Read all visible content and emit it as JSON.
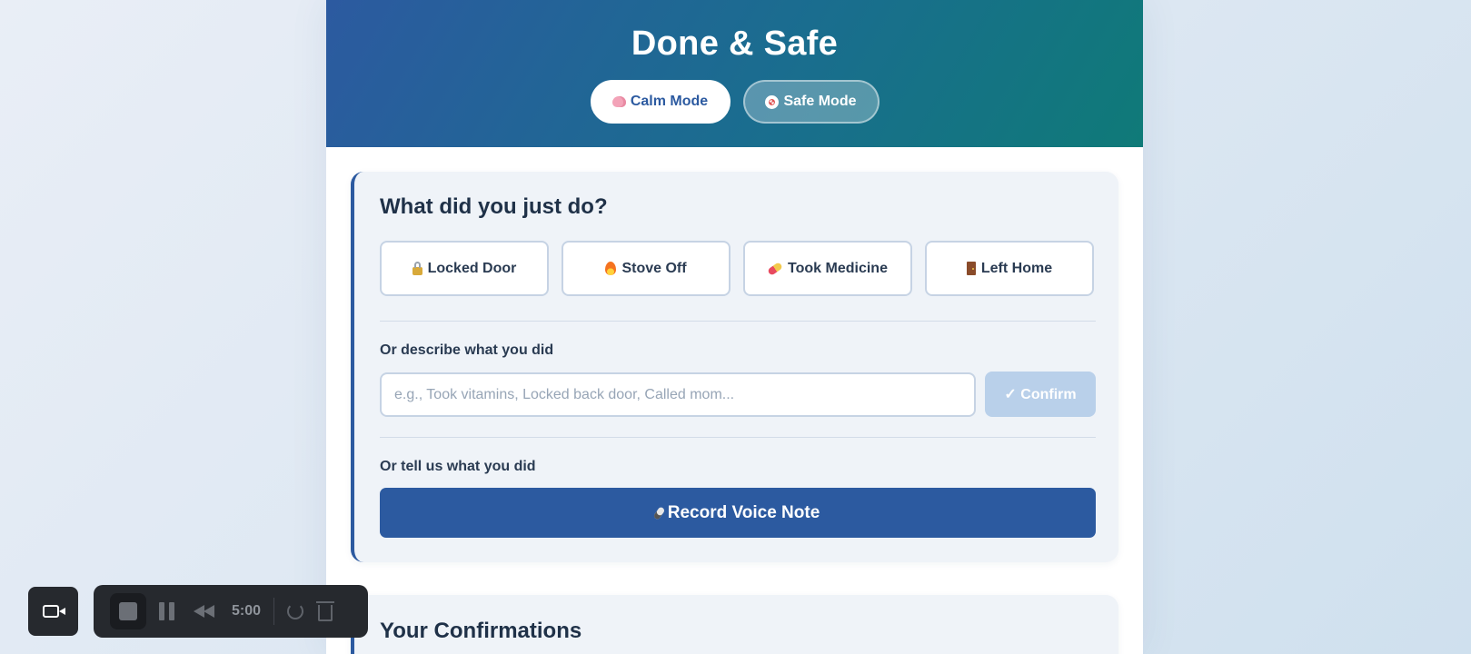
{
  "header": {
    "title": "Done & Safe",
    "modes": [
      {
        "label": "Calm Mode",
        "icon": "brain-icon"
      },
      {
        "label": "Safe Mode",
        "icon": "lifebuoy-icon"
      }
    ]
  },
  "log_card": {
    "title": "What did you just do?",
    "quick_actions": [
      {
        "label": "Locked Door",
        "icon": "lock-icon"
      },
      {
        "label": "Stove Off",
        "icon": "fire-icon"
      },
      {
        "label": "Took Medicine",
        "icon": "pill-icon"
      },
      {
        "label": "Left Home",
        "icon": "door-icon"
      }
    ],
    "describe_label": "Or describe what you did",
    "describe_placeholder": "e.g., Took vitamins, Locked back door, Called mom...",
    "confirm_label": "✓ Confirm",
    "voice_label": "Or tell us what you did",
    "voice_button": "Record Voice Note"
  },
  "confirmations_card": {
    "title": "Your Confirmations"
  },
  "recorder": {
    "timer": "5:00"
  },
  "colors": {
    "primary": "#2c5aa0",
    "header_end": "#0f7a78",
    "card_bg": "#eff3f8"
  }
}
